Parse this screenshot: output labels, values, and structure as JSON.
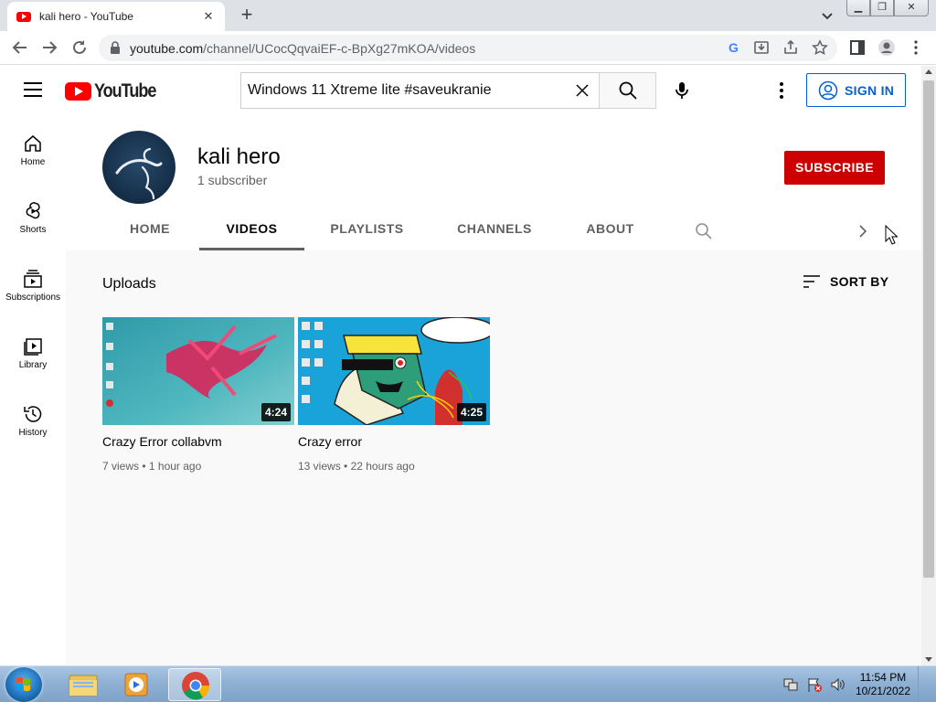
{
  "browser": {
    "tab_title": "kali hero - YouTube",
    "new_tab": "+",
    "url_host": "youtube.com",
    "url_path": "/channel/UCocQqvaiEF-c-BpXg27mKOA/videos"
  },
  "masthead": {
    "logo_text": "YouTube",
    "search_query": "Windows 11 Xtreme lite #saveukranie",
    "sign_in_label": "SIGN IN"
  },
  "guide": {
    "items": [
      {
        "label": "Home",
        "icon": "home-icon"
      },
      {
        "label": "Shorts",
        "icon": "shorts-icon"
      },
      {
        "label": "Subscriptions",
        "icon": "subscriptions-icon"
      },
      {
        "label": "Library",
        "icon": "library-icon"
      },
      {
        "label": "History",
        "icon": "history-icon"
      }
    ]
  },
  "channel": {
    "name": "kali hero",
    "subscribers": "1 subscriber",
    "subscribe_label": "SUBSCRIBE",
    "tabs": [
      {
        "label": "HOME",
        "active": false
      },
      {
        "label": "VIDEOS",
        "active": true
      },
      {
        "label": "PLAYLISTS",
        "active": false
      },
      {
        "label": "CHANNELS",
        "active": false
      },
      {
        "label": "ABOUT",
        "active": false
      }
    ]
  },
  "uploads": {
    "title": "Uploads",
    "sort_label": "SORT BY",
    "videos": [
      {
        "title": "Crazy Error collabvm",
        "duration": "4:24",
        "views": "7 views",
        "age": "1 hour ago"
      },
      {
        "title": "Crazy error",
        "duration": "4:25",
        "views": "13 views",
        "age": "22 hours ago"
      }
    ]
  },
  "taskbar": {
    "time": "11:54 PM",
    "date": "10/21/2022"
  },
  "colors": {
    "youtube_red": "#ff0000",
    "subscribe_red": "#cc0000",
    "sign_in_blue": "#065fd4"
  }
}
